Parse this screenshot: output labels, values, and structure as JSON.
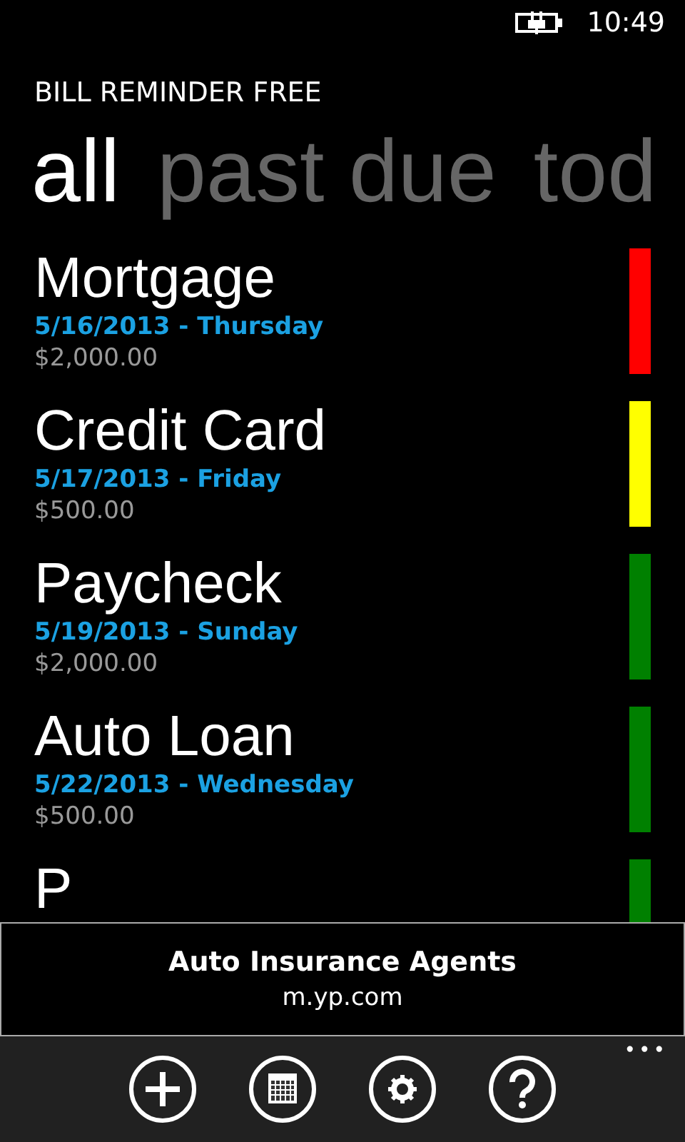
{
  "status_bar": {
    "time": "10:49",
    "charging": true
  },
  "app_title": "BILL REMINDER FREE",
  "pivot": [
    {
      "label": "all",
      "selected": true
    },
    {
      "label": "past due",
      "selected": false
    },
    {
      "label": "tod",
      "selected": false
    }
  ],
  "bills": [
    {
      "name": "Mortgage",
      "date": "5/16/2013 - Thursday",
      "amount": "$2,000.00",
      "color": "#ff0000"
    },
    {
      "name": "Credit Card",
      "date": "5/17/2013 - Friday",
      "amount": "$500.00",
      "color": "#ffff00"
    },
    {
      "name": "Paycheck",
      "date": "5/19/2013 - Sunday",
      "amount": "$2,000.00",
      "color": "#008000"
    },
    {
      "name": "Auto Loan",
      "date": "5/22/2013 - Wednesday",
      "amount": "$500.00",
      "color": "#008000"
    },
    {
      "name": "P",
      "color": "#008000"
    }
  ],
  "ad": {
    "title": "Auto Insurance Agents",
    "url": "m.yp.com"
  },
  "app_bar": {
    "buttons": [
      {
        "kind": "add"
      },
      {
        "kind": "calendar"
      },
      {
        "kind": "settings"
      },
      {
        "kind": "help"
      }
    ],
    "more": "•••"
  }
}
